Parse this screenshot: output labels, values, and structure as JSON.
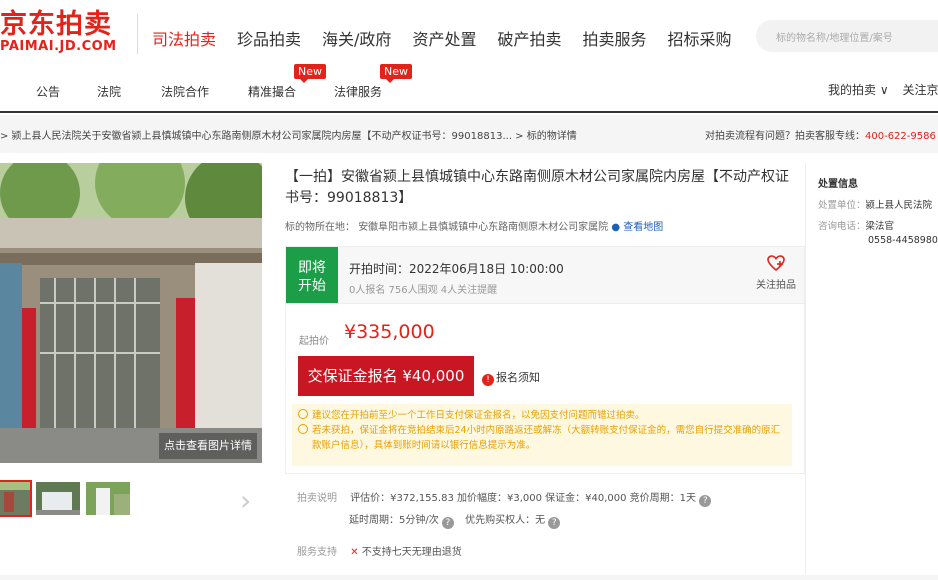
{
  "logo": {
    "cn": "京东拍卖",
    "en": "PAIMAI.JD.COM"
  },
  "main_nav": [
    {
      "label": "司法拍卖",
      "active": true
    },
    {
      "label": "珍品拍卖",
      "active": false
    },
    {
      "label": "海关/政府",
      "active": false
    },
    {
      "label": "资产处置",
      "active": false
    },
    {
      "label": "破产拍卖",
      "active": false
    },
    {
      "label": "拍卖服务",
      "active": false
    },
    {
      "label": "招标采购",
      "active": false
    }
  ],
  "search": {
    "placeholder": "标的物名称/地理位置/案号"
  },
  "sub_nav": {
    "items": [
      "公告",
      "法院",
      "法院合作",
      "精准撮合",
      "法律服务"
    ],
    "badge": "New",
    "my_auction": "我的拍卖 ∨",
    "follow": "关注京"
  },
  "breadcrumb": "> 颍上县人民法院关于安徽省颍上县慎城镇中心东路南侧原木材公司家属院内房屋【不动产权证书号：99018813...   > 标的物详情",
  "hotline": {
    "text": "对拍卖流程有问题？拍卖客服专线：",
    "number": "400-622-9586"
  },
  "gallery": {
    "caption": "点击查看图片详情",
    "next": "›"
  },
  "item": {
    "title": "【一拍】安徽省颍上县慎城镇中心东路南侧原木材公司家属院内房屋【不动产权证书号：99018813】",
    "location_label": "标的物所在地：",
    "location": "安徽阜阳市颍上县慎城镇中心东路南侧原木材公司家属院",
    "map_link": "查看地图",
    "status": "即将开始",
    "start_time": "开拍时间：2022年06月18日 10:00:00",
    "stats": "0人报名   756人围观   4人关注提醒",
    "follow_label": "关注拍品",
    "price_label": "起拍价",
    "price": "¥335,000",
    "deposit_button": "交保证金报名 ¥40,000",
    "notice_link": "报名须知",
    "tips": [
      "建议您在开拍前至少一个工作日支付保证金报名，以免因支付问题而错过拍卖。",
      "若未获拍，保证金将在竞拍结束后24小时内原路返还或解冻（大额转账支付保证金的，需您自行提交准确的原汇款账户信息），具体到账时间请以银行信息提示为准。"
    ],
    "rules_label": "拍卖说明",
    "rules_line1": "评估价：¥372,155.83   加价幅度：¥3,000   保证金：¥40,000   竞价周期：1天",
    "rules_line2a": "延时周期：5分钟/次",
    "rules_line2b": "优先购买权人：无",
    "service_label": "服务支持",
    "service": "不支持七天无理由退货"
  },
  "right_panel": {
    "title": "处置信息",
    "unit_label": "处置单位：",
    "unit": "颍上县人民法院",
    "phone_label": "咨询电话：",
    "contact": "梁法官",
    "phone": "0558-4458980"
  },
  "colors": {
    "brand": "#e2231a",
    "status_green": "#1b9e47",
    "button_red": "#c81623",
    "tip_bg": "#fff8e1",
    "map_link": "#1f5fb5"
  }
}
